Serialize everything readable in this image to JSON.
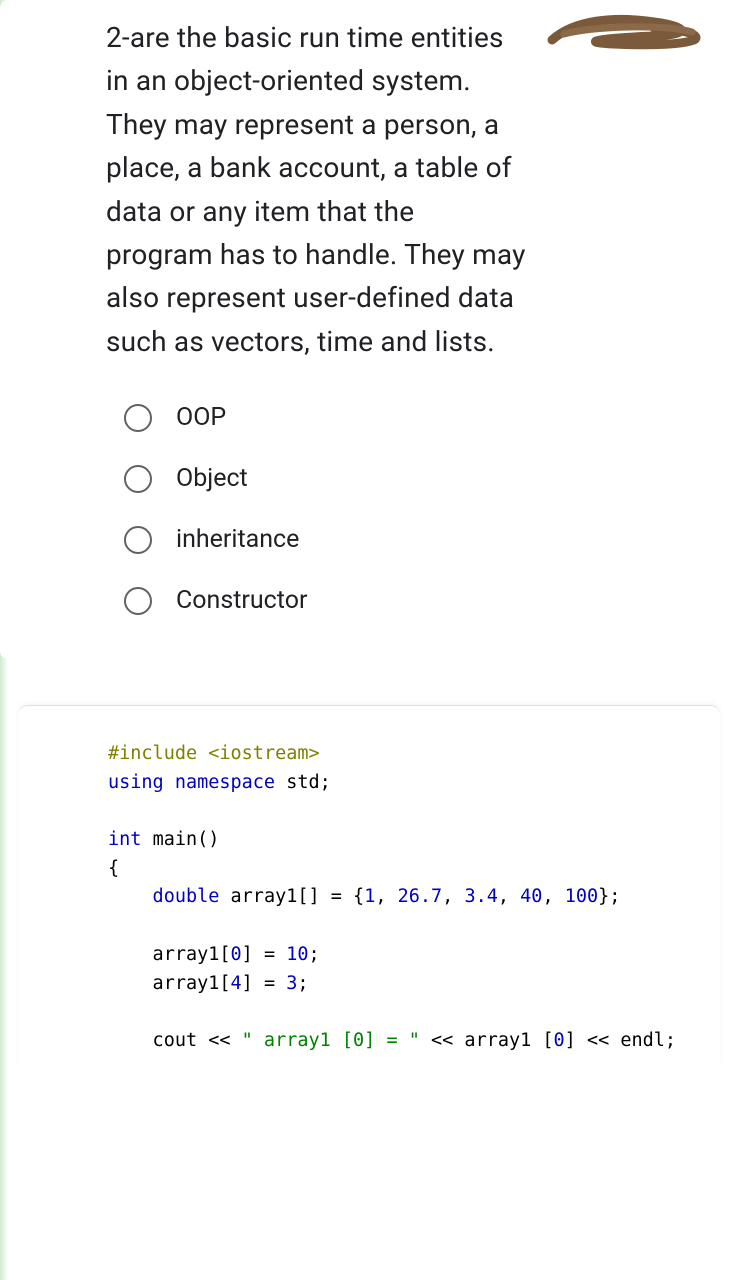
{
  "question": {
    "text": "2-are the basic run time entities in an object-oriented system. They may represent a person, a place, a bank account, a table of data or any item that the program has to handle. They may also represent user-defined data such as vectors, time and lists.",
    "options": [
      {
        "label": "OOP"
      },
      {
        "label": "Object"
      },
      {
        "label": "inheritance"
      },
      {
        "label": "Constructor"
      }
    ]
  },
  "code": {
    "line1a": "#include ",
    "line1b": "<iostream>",
    "line2a": "using ",
    "line2b": "namespace ",
    "line2c": "std;",
    "line4a": "int ",
    "line4b": "main()",
    "line5": "{",
    "line6a": "    double ",
    "line6b": "array1[] = {",
    "line6c": "1",
    "line6d": ", ",
    "line6e": "26.7",
    "line6f": ", ",
    "line6g": "3.4",
    "line6h": ", ",
    "line6i": "40",
    "line6j": ", ",
    "line6k": "100",
    "line6l": "};",
    "line8a": "    array1[",
    "line8b": "0",
    "line8c": "] = ",
    "line8d": "10",
    "line8e": ";",
    "line9a": "    array1[",
    "line9b": "4",
    "line9c": "] = ",
    "line9d": "3",
    "line9e": ";",
    "line11a": "    cout << ",
    "line11b": "\" array1 [0] = \"",
    "line11c": " << array1 [",
    "line11d": "0",
    "line11e": "] << endl;"
  }
}
